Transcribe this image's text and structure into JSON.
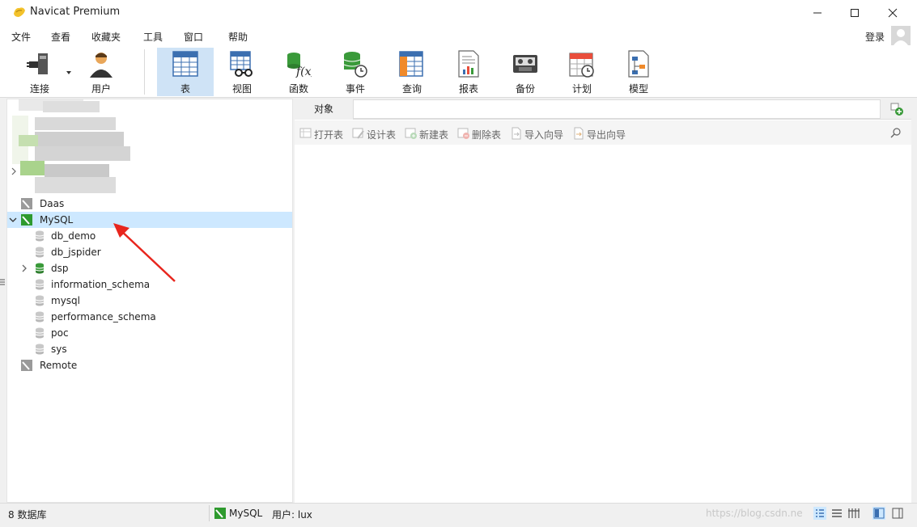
{
  "window": {
    "title": "Navicat Premium"
  },
  "menu": [
    "文件",
    "查看",
    "收藏夹",
    "工具",
    "窗口",
    "帮助"
  ],
  "login_label": "登录",
  "toolbar": {
    "connect": "连接",
    "user": "用户",
    "table": "表",
    "view": "视图",
    "function": "函数",
    "event": "事件",
    "query": "查询",
    "report": "报表",
    "backup": "备份",
    "schedule": "计划",
    "model": "模型"
  },
  "tree": {
    "connections": [
      {
        "name": "Daas",
        "expanded": false
      },
      {
        "name": "MySQL",
        "expanded": true,
        "selected": true
      },
      {
        "name": "Remote",
        "expanded": false
      }
    ],
    "databases": [
      {
        "name": "db_demo",
        "open": false
      },
      {
        "name": "db_jspider",
        "open": false
      },
      {
        "name": "dsp",
        "open": true
      },
      {
        "name": "information_schema",
        "open": false
      },
      {
        "name": "mysql",
        "open": false
      },
      {
        "name": "performance_schema",
        "open": false
      },
      {
        "name": "poc",
        "open": false
      },
      {
        "name": "sys",
        "open": false
      }
    ]
  },
  "objects_tab": {
    "label": "对象",
    "actions": [
      "打开表",
      "设计表",
      "新建表",
      "删除表",
      "导入向导",
      "导出向导"
    ]
  },
  "status": {
    "db_count": "8 数据库",
    "connection": "MySQL",
    "user": "用户: lux",
    "watermark": "https://blog.csdn.ne"
  },
  "colors": {
    "accent_selected": "#cde8ff",
    "toolbar_active": "#cfe3f6",
    "mysql_green": "#2e9a2e",
    "arrow_red": "#e8251d"
  }
}
